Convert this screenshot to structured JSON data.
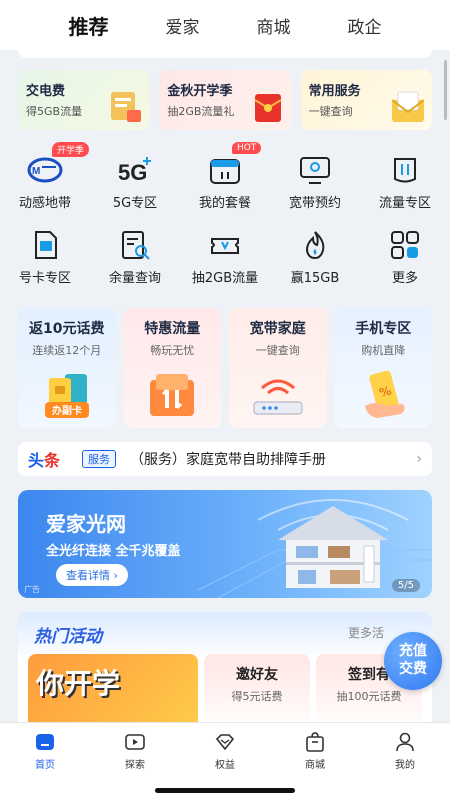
{
  "top_tabs": [
    {
      "label": "推荐",
      "active": true
    },
    {
      "label": "爱家"
    },
    {
      "label": "商城"
    },
    {
      "label": "政企"
    }
  ],
  "promo_cards": [
    {
      "title": "交电费",
      "subtitle": "得5GB流量"
    },
    {
      "title": "金秋开学季",
      "subtitle": "抽2GB流量礼"
    },
    {
      "title": "常用服务",
      "subtitle": "一键查询"
    }
  ],
  "quick_icons": [
    {
      "label": "动感地带",
      "icon": "dongganzone-logo-icon",
      "badge": "开学季"
    },
    {
      "label": "5G专区",
      "icon": "5g-icon"
    },
    {
      "label": "我的套餐",
      "icon": "calendar-package-icon",
      "badge": "HOT"
    },
    {
      "label": "宽带预约",
      "icon": "monitor-icon"
    },
    {
      "label": "流量专区",
      "icon": "traffic-icon"
    },
    {
      "label": "号卡专区",
      "icon": "sim-card-icon"
    },
    {
      "label": "余量查询",
      "icon": "search-document-icon"
    },
    {
      "label": "抽2GB流量",
      "icon": "ticket-icon"
    },
    {
      "label": "赢15GB",
      "icon": "flame-icon"
    },
    {
      "label": "更多",
      "icon": "grid-more-icon"
    }
  ],
  "feature_cards": [
    {
      "title": "返10元话费",
      "subtitle": "连续返12个月",
      "tag": "办副卡"
    },
    {
      "title": "特惠流量",
      "subtitle": "畅玩无忧"
    },
    {
      "title": "宽带家庭",
      "subtitle": "一键查询"
    },
    {
      "title": "手机专区",
      "subtitle": "购机直降"
    }
  ],
  "headline": {
    "logo_a": "头",
    "logo_b": "条",
    "tag": "服务",
    "text": "（服务）家庭宽带自助排障手册",
    "chevron": "›"
  },
  "banner": {
    "title": "爱家光网",
    "subtitle": "全光纤连接  全千兆覆盖",
    "button": "查看详情 ›",
    "ad": "广告",
    "page": "5/5"
  },
  "hot": {
    "title": "热门活动",
    "more": "更多活",
    "big_text": "你开学",
    "cards": [
      {
        "title": "邀好友",
        "subtitle": "得5元话费"
      },
      {
        "title": "签到有",
        "subtitle": "抽100元话费"
      }
    ]
  },
  "float_button": {
    "line1": "充值",
    "line2": "交费"
  },
  "bottom_nav": [
    {
      "label": "首页",
      "icon": "home-icon",
      "active": true
    },
    {
      "label": "探索",
      "icon": "play-icon"
    },
    {
      "label": "权益",
      "icon": "diamond-icon"
    },
    {
      "label": "商城",
      "icon": "bag-icon"
    },
    {
      "label": "我的",
      "icon": "user-icon"
    }
  ],
  "colors": {
    "accent": "#1a63e8",
    "hot_red": "#ff4d4f",
    "background": "#eef2f7"
  }
}
